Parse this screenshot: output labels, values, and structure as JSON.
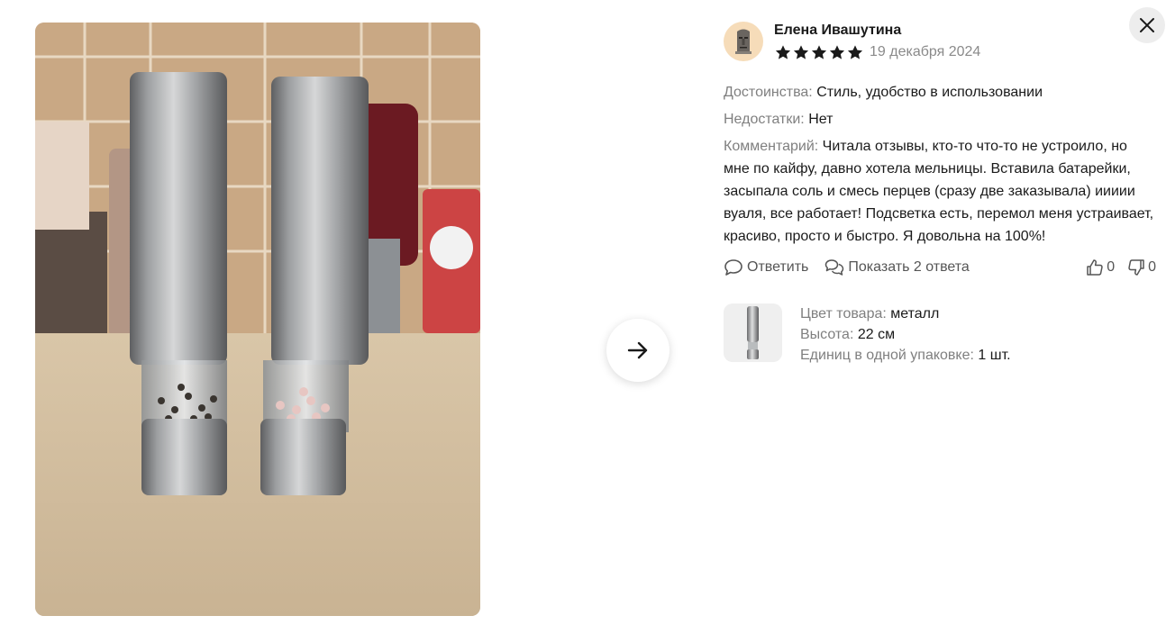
{
  "review": {
    "author": "Елена Ивашутина",
    "rating": 5,
    "rating_max": 5,
    "date": "19 декабря 2024",
    "advantages_label": "Достоинства:",
    "advantages": "Стиль, удобство в использовании",
    "disadvantages_label": "Недостатки:",
    "disadvantages": "Нет",
    "comment_label": "Комментарий:",
    "comment": "Читала отзывы, кто-то что-то не устроило, но мне по кайфу, давно хотела мельницы. Вставила батарейки, засыпала соль и смесь перцев (сразу две заказывала) иииии вуаля, все работает! Подсветка есть, перемол меня устраивает, красиво, просто и быстро. Я довольна на 100%!"
  },
  "actions": {
    "reply": "Ответить",
    "show_replies": "Показать 2 ответа",
    "likes": "0",
    "dislikes": "0"
  },
  "product": {
    "color_label": "Цвет товара:",
    "color": "металл",
    "height_label": "Высота:",
    "height": "22 см",
    "units_label": "Единиц в одной упаковке:",
    "units": "1 шт."
  },
  "icons": {
    "close": "close-icon",
    "next": "arrow-right-icon",
    "reply": "speech-bubble-icon",
    "replies": "two-bubbles-icon",
    "like": "thumb-up-icon",
    "dislike": "thumb-down-icon",
    "star": "star-icon"
  },
  "colors": {
    "star": "#1a1a1a",
    "muted_text": "#7f7f7f",
    "avatar_bg": "#f6dcb9",
    "close_bg": "#ededed"
  }
}
